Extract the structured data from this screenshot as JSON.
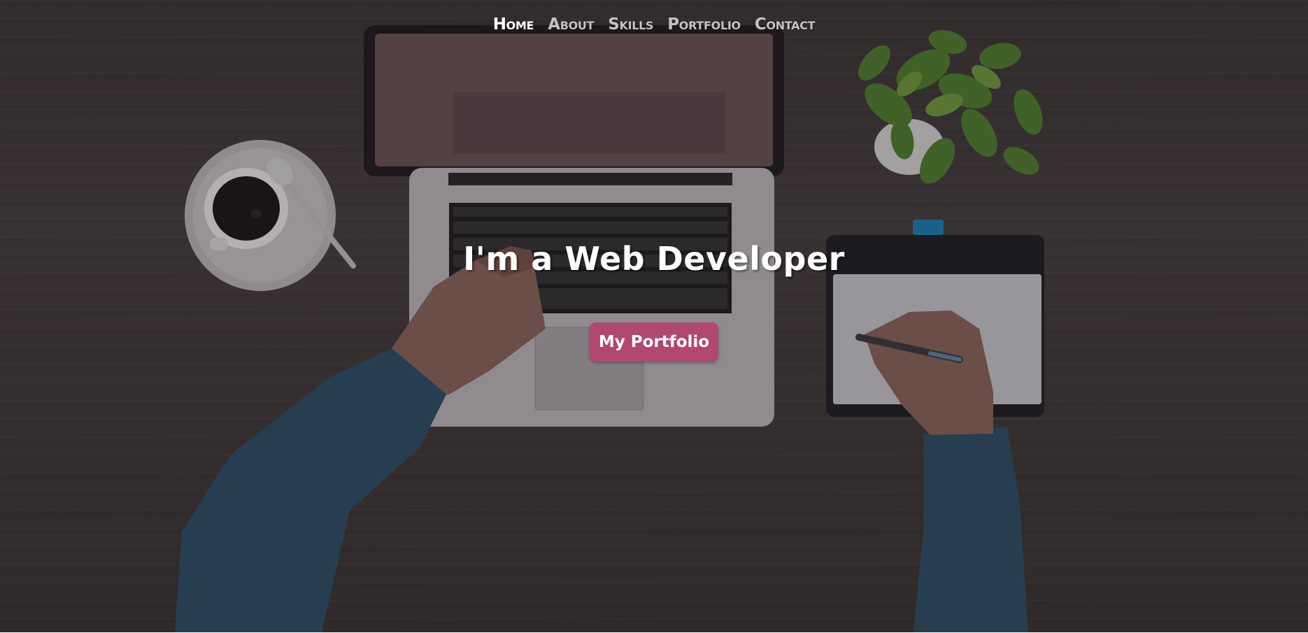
{
  "nav": {
    "items": [
      {
        "label": "Home",
        "active": true
      },
      {
        "label": "About",
        "active": false
      },
      {
        "label": "Skills",
        "active": false
      },
      {
        "label": "Portfolio",
        "active": false
      },
      {
        "label": "Contact",
        "active": false
      }
    ]
  },
  "hero": {
    "headline": "I'm a Web Developer",
    "cta_label": "My Portfolio"
  },
  "colors": {
    "accent": "#b2486f",
    "nav_active": "#ffffff",
    "nav_inactive": "#c8c0c0",
    "desk_wood": "#433a38"
  },
  "background": {
    "icons": [
      "laptop-icon",
      "coffee-cup-icon",
      "plant-icon",
      "drawing-tablet-icon",
      "stylus-pen-icon"
    ]
  }
}
